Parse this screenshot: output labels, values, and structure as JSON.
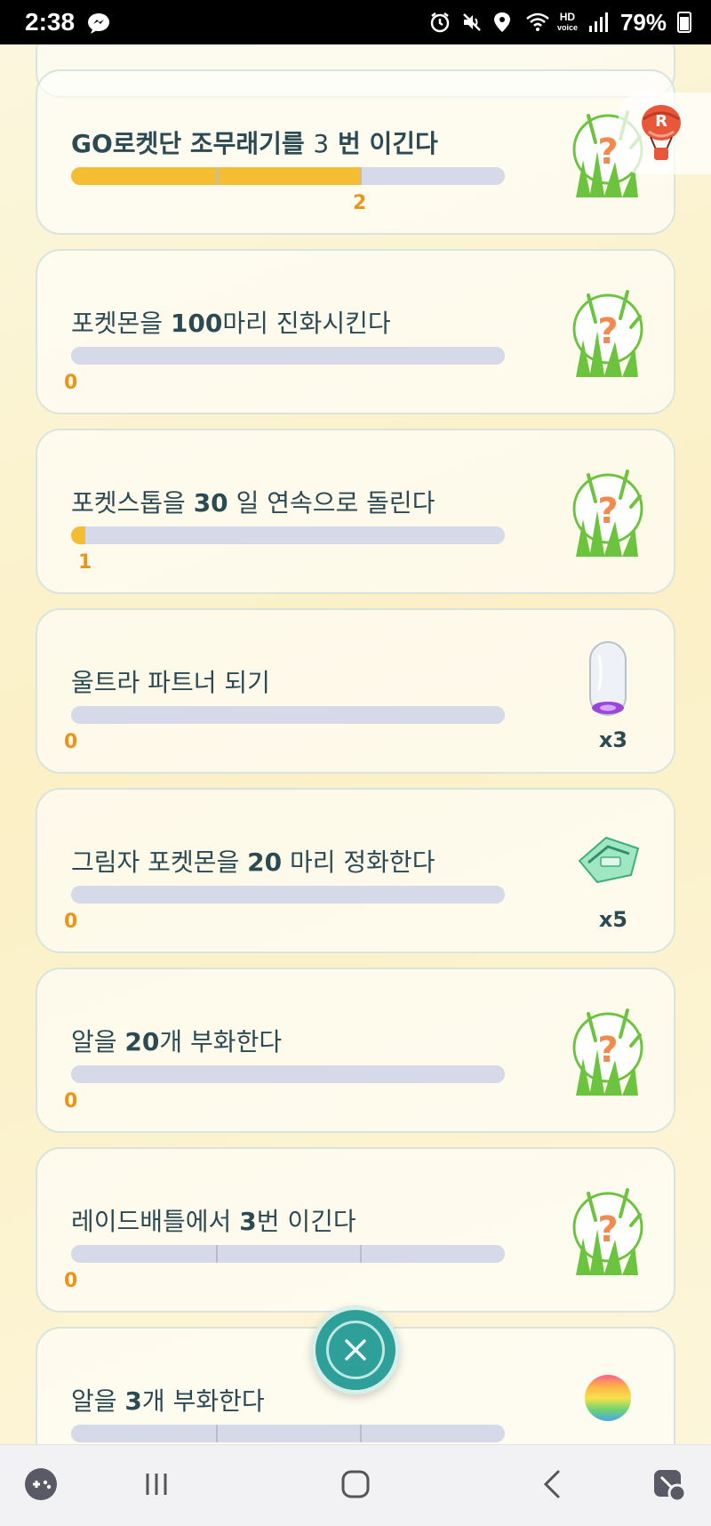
{
  "status_bar": {
    "time": "2:38",
    "battery": "79%",
    "hd_label_top": "HD",
    "hd_label_bottom": "voice",
    "icons": [
      "messenger-icon",
      "alarm-icon",
      "mute-icon",
      "location-icon",
      "wifi-icon",
      "signal-icon",
      "battery-icon"
    ]
  },
  "side_tab": {
    "icon": "rocket-balloon-icon"
  },
  "tasks": [
    {
      "title_parts": [
        "GO",
        "로켓단 조무래기를 ",
        "3",
        " 번 이긴다"
      ],
      "progress_label": "2",
      "progress_fraction": 0.667,
      "segments": 3,
      "reward": "mystery-reward-icon"
    },
    {
      "title_parts": [
        "포켓몬을 ",
        "100",
        "마리 진화시킨다"
      ],
      "progress_label": "0",
      "progress_fraction": 0,
      "segments": 1,
      "reward": "mystery-reward-icon"
    },
    {
      "title_parts": [
        "포켓스톱을 ",
        "30",
        " 일 연속으로 돌린다"
      ],
      "progress_label": "1",
      "progress_fraction": 0.033,
      "segments": 1,
      "reward": "mystery-reward-icon"
    },
    {
      "title_parts": [
        "울트라 파트너 되기",
        "",
        ""
      ],
      "progress_label": "0",
      "progress_fraction": 0,
      "segments": 1,
      "reward": "incense-icon",
      "reward_qty": "x3"
    },
    {
      "title_parts": [
        "그림자 포켓몬을 ",
        "20",
        " 마리 정화한다"
      ],
      "progress_label": "0",
      "progress_fraction": 0,
      "segments": 1,
      "reward": "raid-pass-icon",
      "reward_qty": "x5"
    },
    {
      "title_parts": [
        "알을 ",
        "20",
        "개 부화한다"
      ],
      "progress_label": "0",
      "progress_fraction": 0,
      "segments": 1,
      "reward": "mystery-reward-icon"
    },
    {
      "title_parts": [
        "레이드배틀에서 ",
        "3",
        "번 이긴다"
      ],
      "progress_label": "0",
      "progress_fraction": 0,
      "segments": 3,
      "reward": "mystery-reward-icon"
    },
    {
      "title_parts": [
        "알을 ",
        "3",
        "개 부화한다"
      ],
      "progress_label": "",
      "progress_fraction": 0,
      "segments": 3,
      "reward": "rainbow-ball-icon"
    }
  ],
  "close_button": {
    "icon": "close-icon"
  },
  "nav_bar": {
    "items": [
      "game-launcher-icon",
      "recent-apps-icon",
      "home-icon",
      "back-icon",
      "assistant-icon"
    ]
  },
  "colors": {
    "accent_progress": "#f5bd32",
    "progress_track": "#d5d9e8",
    "progress_value": "#e9951a",
    "title_text": "#2c4a52",
    "close_button": "#2f9f9a",
    "reward_grass": "#6cc43e",
    "reward_question": "#f08a4e"
  }
}
